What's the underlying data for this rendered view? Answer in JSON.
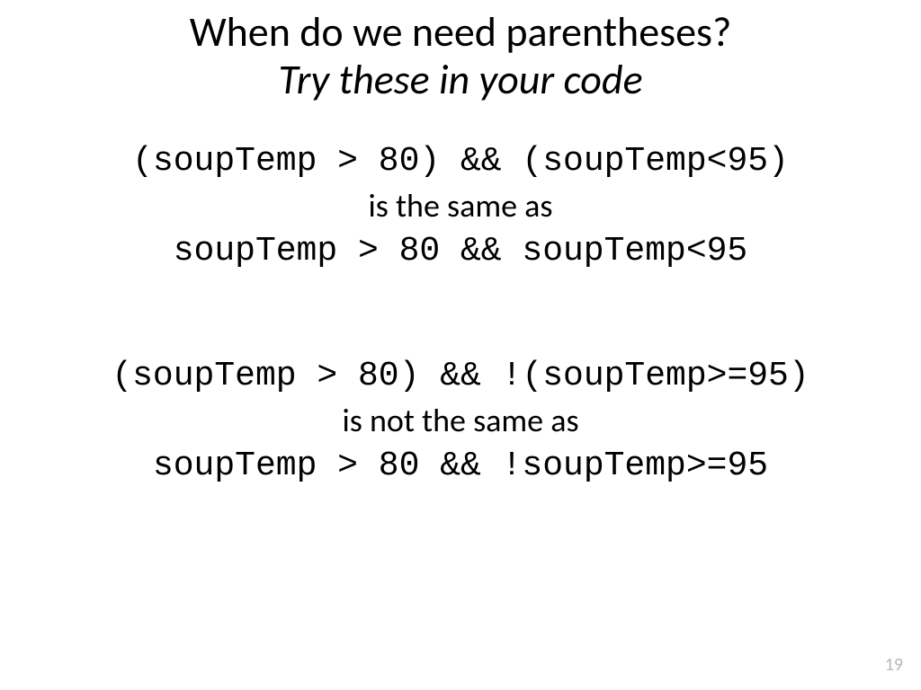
{
  "title": "When do we need parentheses?",
  "subtitle": "Try these in your code",
  "block1": {
    "code1": "(soupTemp > 80) && (soupTemp<95)",
    "narr": "is the same as",
    "code2": "soupTemp > 80 && soupTemp<95"
  },
  "block2": {
    "code1": "(soupTemp > 80) && !(soupTemp>=95)",
    "narr": "is not the same as",
    "code2": "soupTemp > 80 && !soupTemp>=95"
  },
  "page_number": "19"
}
